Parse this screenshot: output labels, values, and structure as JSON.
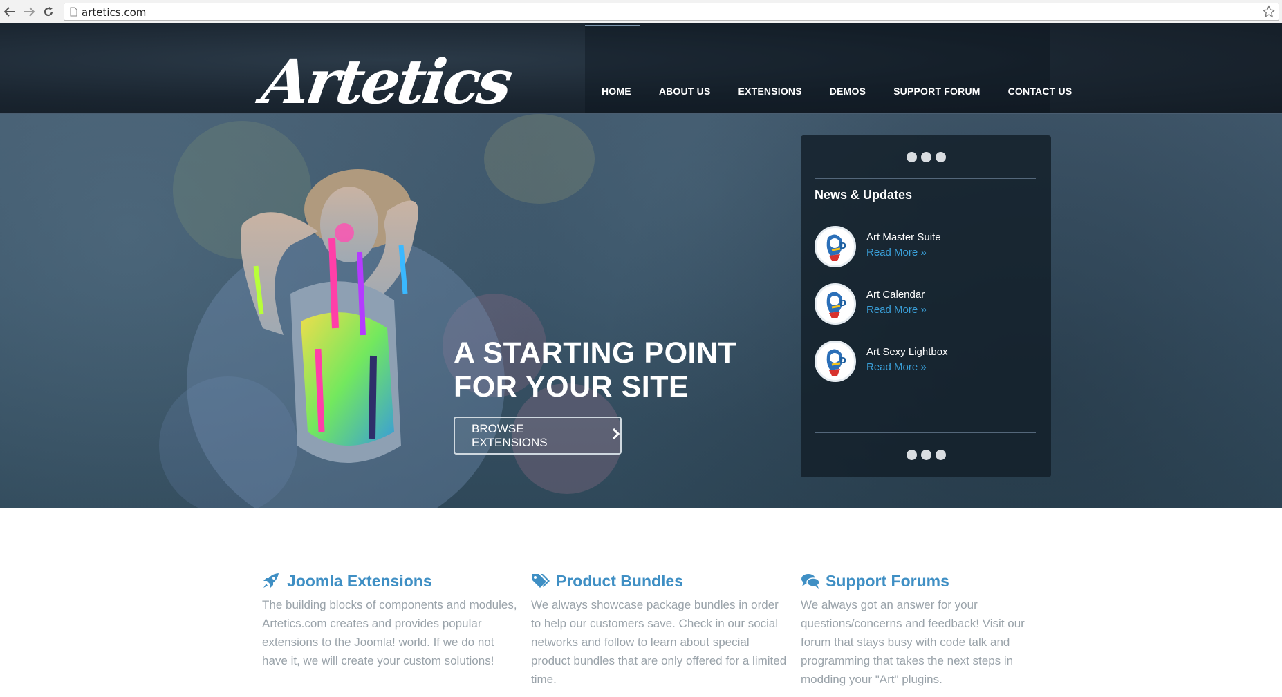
{
  "browser": {
    "url": "artetics.com"
  },
  "header": {
    "logo_text": "Artetics",
    "nav": [
      {
        "label": "HOME"
      },
      {
        "label": "ABOUT US"
      },
      {
        "label": "EXTENSIONS"
      },
      {
        "label": "DEMOS"
      },
      {
        "label": "SUPPORT FORUM"
      },
      {
        "label": "CONTACT US"
      }
    ]
  },
  "hero": {
    "title_line1": "A STARTING POINT",
    "title_line2": "FOR YOUR SITE",
    "button_label": "BROWSE EXTENSIONS",
    "button_icon": "chevron-right-icon"
  },
  "news": {
    "heading": "News & Updates",
    "items": [
      {
        "title": "Art Master Suite",
        "link": "Read More »"
      },
      {
        "title": "Art Calendar",
        "link": "Read More »"
      },
      {
        "title": "Art Sexy Lightbox",
        "link": "Read More »"
      }
    ]
  },
  "features": [
    {
      "icon": "rocket-icon",
      "title": "Joomla Extensions",
      "text": "The building blocks of components and modules, Artetics.com creates and provides popular extensions to the Joomla! world. If we do not have it, we will create your custom solutions!"
    },
    {
      "icon": "tags-icon",
      "title": "Product Bundles",
      "text": "We always showcase package bundles in order to help our customers save. Check in our social networks and follow to learn about special product bundles that are only offered for a limited time."
    },
    {
      "icon": "comments-icon",
      "title": "Support Forums",
      "text": "We always got an answer for your questions/concerns and feedback! Visit our forum that stays busy with code talk and programming that takes the next steps in modding your \"Art\" plugins."
    }
  ],
  "colors": {
    "accent_blue": "#3f8fc4",
    "link_blue": "#3a9fd8",
    "header_dark": "#1a2530",
    "body_text": "#9aa3aa"
  }
}
